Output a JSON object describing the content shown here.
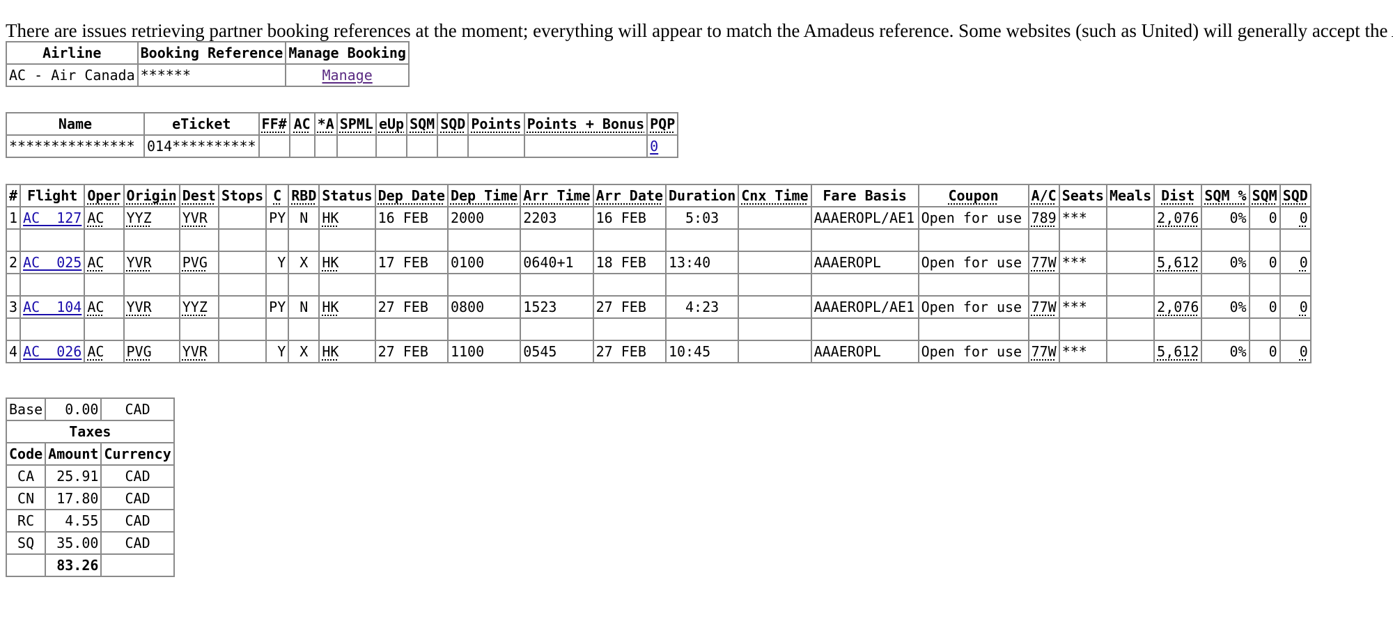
{
  "notice": "There are issues retrieving partner booking references at the moment; everything will appear to match the Amadeus reference. Some websites (such as United) will generally accept the A",
  "booking": {
    "headers": [
      "Airline",
      "Booking Reference",
      "Manage Booking"
    ],
    "row": {
      "airline": "AC - Air Canada",
      "reference": "******",
      "manage": "Manage"
    }
  },
  "passengers": {
    "headers": [
      "Name",
      "eTicket",
      "FF#",
      "AC",
      "*A",
      "SPML",
      "eUp",
      "SQM",
      "SQD",
      "Points",
      "Points + Bonus",
      "PQP"
    ],
    "rows": [
      {
        "name": "***************",
        "eticket": "014**********",
        "ff": "",
        "ac": "",
        "star": "",
        "spml": "",
        "eup": "",
        "sqm": "",
        "sqd": "",
        "points": "",
        "points_bonus": "",
        "pqp": "0"
      }
    ]
  },
  "segments": {
    "headers": [
      "#",
      "Flight",
      "Oper",
      "Origin",
      "Dest",
      "Stops",
      "C",
      "RBD",
      "Status",
      "Dep Date",
      "Dep Time",
      "Arr Time",
      "Arr Date",
      "Duration",
      "Cnx Time",
      "Fare Basis",
      "Coupon",
      "A/C",
      "Seats",
      "Meals",
      "Dist",
      "SQM %",
      "SQM",
      "SQD"
    ],
    "rows": [
      {
        "num": "1",
        "flight": "AC  127",
        "oper": "AC",
        "origin": "YYZ",
        "dest": "YVR",
        "stops": "",
        "cls": "PY",
        "rbd": "N",
        "status": "HK",
        "dep_date": "16 FEB",
        "dep_time": "2000",
        "arr_time": "2203",
        "arr_date": "16 FEB",
        "duration": "5:03",
        "cnx": "",
        "fare_basis": "AAAEROPL/AE1",
        "coupon": "Open for use",
        "ac": "789",
        "seats": "***",
        "meals": "",
        "dist": "2,076",
        "sqm_pct": "0%",
        "sqm": "0",
        "sqd": "0"
      },
      {
        "num": "2",
        "flight": "AC  025",
        "oper": "AC",
        "origin": "YVR",
        "dest": "PVG",
        "stops": "",
        "cls": "Y",
        "rbd": "X",
        "status": "HK",
        "dep_date": "17 FEB",
        "dep_time": "0100",
        "arr_time": "0640+1",
        "arr_date": "18 FEB",
        "duration": "13:40",
        "cnx": "",
        "fare_basis": "AAAEROPL",
        "coupon": "Open for use",
        "ac": "77W",
        "seats": "***",
        "meals": "",
        "dist": "5,612",
        "sqm_pct": "0%",
        "sqm": "0",
        "sqd": "0"
      },
      {
        "num": "3",
        "flight": "AC  104",
        "oper": "AC",
        "origin": "YVR",
        "dest": "YYZ",
        "stops": "",
        "cls": "PY",
        "rbd": "N",
        "status": "HK",
        "dep_date": "27 FEB",
        "dep_time": "0800",
        "arr_time": "1523",
        "arr_date": "27 FEB",
        "duration": "4:23",
        "cnx": "",
        "fare_basis": "AAAEROPL/AE1",
        "coupon": "Open for use",
        "ac": "77W",
        "seats": "***",
        "meals": "",
        "dist": "2,076",
        "sqm_pct": "0%",
        "sqm": "0",
        "sqd": "0"
      },
      {
        "num": "4",
        "flight": "AC  026",
        "oper": "AC",
        "origin": "PVG",
        "dest": "YVR",
        "stops": "",
        "cls": "Y",
        "rbd": "X",
        "status": "HK",
        "dep_date": "27 FEB",
        "dep_time": "1100",
        "arr_time": "0545",
        "arr_date": "27 FEB",
        "duration": "10:45",
        "cnx": "",
        "fare_basis": "AAAEROPL",
        "coupon": "Open for use",
        "ac": "77W",
        "seats": "***",
        "meals": "",
        "dist": "5,612",
        "sqm_pct": "0%",
        "sqm": "0",
        "sqd": "0"
      }
    ]
  },
  "fare": {
    "base_label": "Base",
    "base_amount": "0.00",
    "base_currency": "CAD",
    "taxes_label": "Taxes",
    "headers": [
      "Code",
      "Amount",
      "Currency"
    ],
    "taxes": [
      {
        "code": "CA",
        "amount": "25.91",
        "currency": "CAD"
      },
      {
        "code": "CN",
        "amount": "17.80",
        "currency": "CAD"
      },
      {
        "code": "RC",
        "amount": "4.55",
        "currency": "CAD"
      },
      {
        "code": "SQ",
        "amount": "35.00",
        "currency": "CAD"
      }
    ],
    "total": "83.26"
  }
}
